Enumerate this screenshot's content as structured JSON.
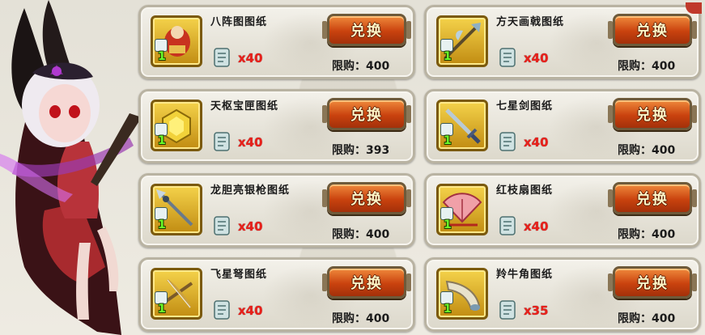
{
  "button_label": "兑换",
  "limit_label": "限购：",
  "cards": [
    {
      "title": "八阵图图纸",
      "qty": "1",
      "cost": "x40",
      "limit": "400",
      "icon": "doll-relic-icon"
    },
    {
      "title": "方天画戟图纸",
      "qty": "1",
      "cost": "x40",
      "limit": "400",
      "icon": "halberd-icon"
    },
    {
      "title": "天枢宝匣图纸",
      "qty": "1",
      "cost": "x40",
      "limit": "393",
      "icon": "treasure-box-icon"
    },
    {
      "title": "七星剑图纸",
      "qty": "1",
      "cost": "x40",
      "limit": "400",
      "icon": "sword-icon"
    },
    {
      "title": "龙胆亮银枪图纸",
      "qty": "1",
      "cost": "x40",
      "limit": "400",
      "icon": "spear-icon"
    },
    {
      "title": "红枝扇图纸",
      "qty": "1",
      "cost": "x40",
      "limit": "400",
      "icon": "fan-icon"
    },
    {
      "title": "飞星弩图纸",
      "qty": "1",
      "cost": "x40",
      "limit": "400",
      "icon": "crossbow-icon"
    },
    {
      "title": "羚牛角图纸",
      "qty": "1",
      "cost": "x35",
      "limit": "400",
      "icon": "horn-icon"
    }
  ],
  "colors": {
    "cost": "#e8201a",
    "button": "#d04a12",
    "qty": "#6bff2a"
  }
}
